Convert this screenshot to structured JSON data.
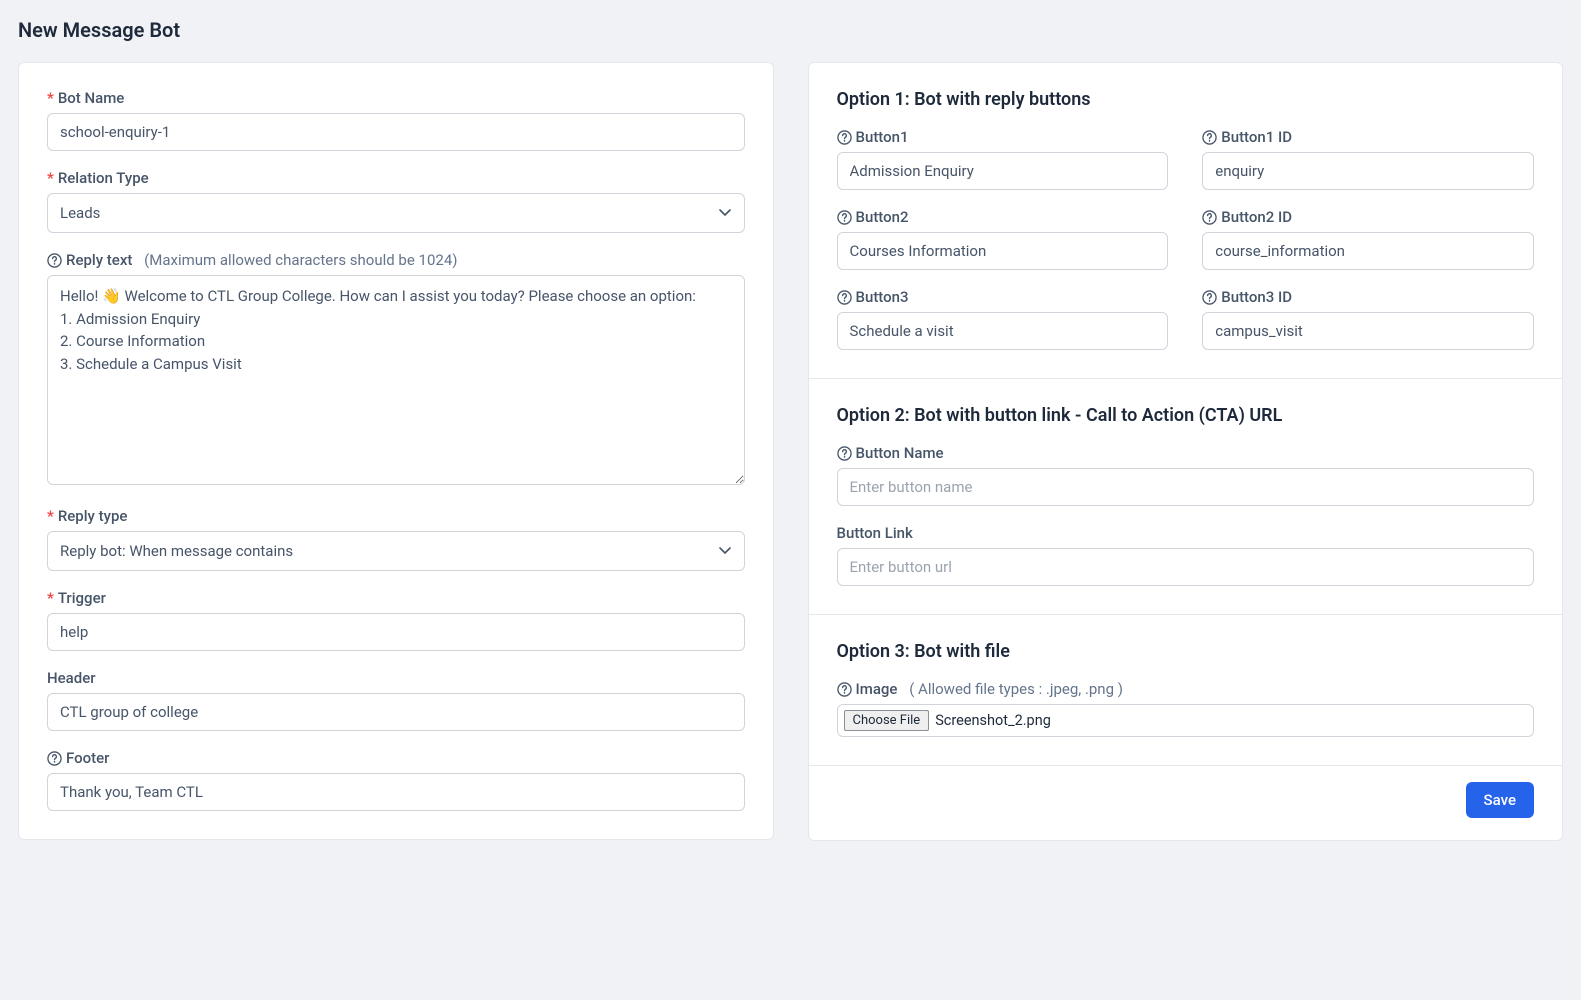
{
  "page": {
    "title": "New Message Bot"
  },
  "left": {
    "botName": {
      "label": "Bot Name",
      "value": "school-enquiry-1"
    },
    "relationType": {
      "label": "Relation Type",
      "value": "Leads"
    },
    "replyText": {
      "label": "Reply text",
      "hint": "(Maximum allowed characters should be 1024)",
      "value": "Hello! 👋 Welcome to CTL Group College. How can I assist you today? Please choose an option:\n1. Admission Enquiry\n2. Course Information\n3. Schedule a Campus Visit"
    },
    "replyType": {
      "label": "Reply type",
      "value": "Reply bot: When message contains"
    },
    "trigger": {
      "label": "Trigger",
      "value": "help"
    },
    "header": {
      "label": "Header",
      "value": "CTL group of college"
    },
    "footer": {
      "label": "Footer",
      "value": "Thank you, Team CTL"
    }
  },
  "option1": {
    "title": "Option 1: Bot with reply buttons",
    "rows": [
      {
        "label": "Button1",
        "value": "Admission Enquiry",
        "idLabel": "Button1 ID",
        "idValue": "enquiry"
      },
      {
        "label": "Button2",
        "value": "Courses Information",
        "idLabel": "Button2 ID",
        "idValue": "course_information"
      },
      {
        "label": "Button3",
        "value": "Schedule a visit",
        "idLabel": "Button3 ID",
        "idValue": "campus_visit"
      }
    ]
  },
  "option2": {
    "title": "Option 2: Bot with button link - Call to Action (CTA) URL",
    "buttonName": {
      "label": "Button Name",
      "placeholder": "Enter button name"
    },
    "buttonLink": {
      "label": "Button Link",
      "placeholder": "Enter button url"
    }
  },
  "option3": {
    "title": "Option 3: Bot with file",
    "image": {
      "label": "Image",
      "hint": "( Allowed file types : .jpeg, .png )",
      "chooseLabel": "Choose File",
      "fileName": "Screenshot_2.png"
    }
  },
  "actions": {
    "save": "Save"
  }
}
